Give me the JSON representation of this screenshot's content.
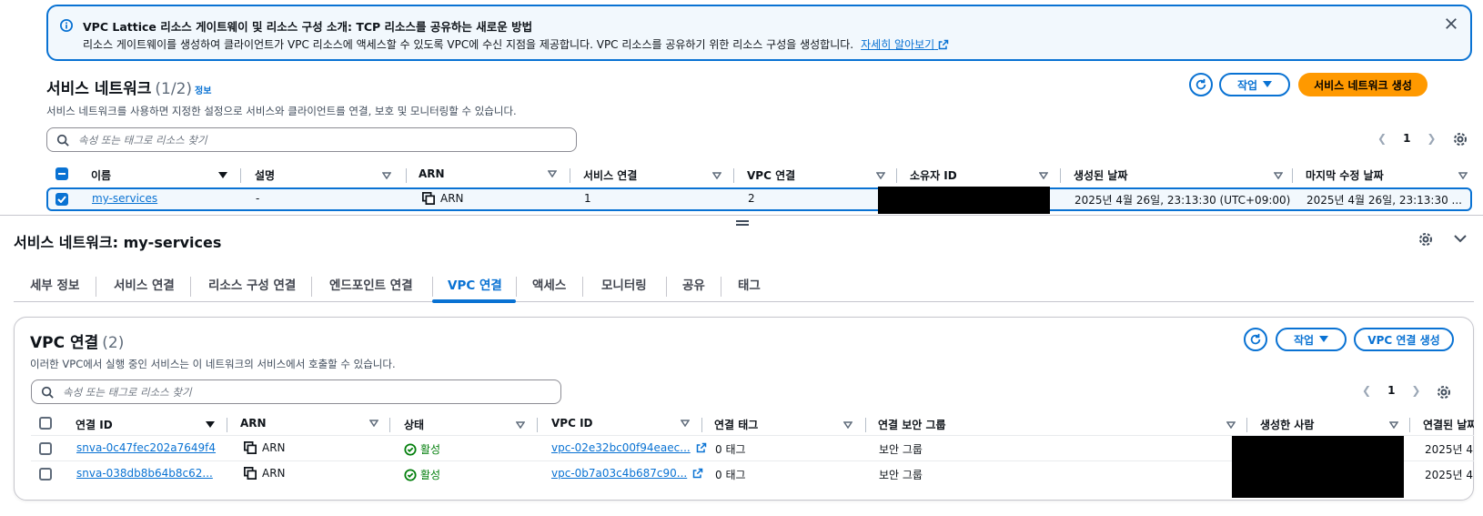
{
  "banner": {
    "title": "VPC Lattice 리소스 게이트웨이 및 리소스 구성 소개: TCP 리소스를 공유하는 새로운 방법",
    "description": "리소스 게이트웨이를 생성하여 클라이언트가 VPC 리소스에 액세스할 수 있도록 VPC에 수신 지점을 제공합니다. VPC 리소스를 공유하기 위한 리소스 구성을 생성합니다.",
    "learn_more": "자세히 알아보기"
  },
  "networks": {
    "title": "서비스 네트워크",
    "count": "(1/2)",
    "info": "정보",
    "description": "서비스 네트워크를 사용하면 지정한 설정으로 서비스와 클라이언트를 연결, 보호 및 모니터링할 수 있습니다.",
    "actions_label": "작업",
    "create_label": "서비스 네트워크 생성",
    "search_placeholder": "속성 또는 태그로 리소스 찾기",
    "page": "1",
    "columns": [
      "이름",
      "설명",
      "ARN",
      "서비스 연결",
      "VPC 연결",
      "소유자 ID",
      "생성된 날짜",
      "마지막 수정 날짜"
    ],
    "rows": [
      {
        "name": "my-services",
        "description": "-",
        "arn": "ARN",
        "service_assoc": "1",
        "vpc_assoc": "2",
        "created": "2025년 4월 26일, 23:13:30 (UTC+09:00)",
        "modified": "2025년 4월 26일, 23:13:30 ..."
      }
    ]
  },
  "details": {
    "title": "서비스 네트워크: my-services",
    "tabs": [
      "세부 정보",
      "서비스 연결",
      "리소스 구성 연결",
      "엔드포인트 연결",
      "VPC 연결",
      "액세스",
      "모니터링",
      "공유",
      "태그"
    ],
    "active_tab": "VPC 연결"
  },
  "vpc_assoc": {
    "title": "VPC 연결",
    "count": "(2)",
    "description": "이러한 VPC에서 실행 중인 서비스는 이 네트워크의 서비스에서 호출할 수 있습니다.",
    "actions_label": "작업",
    "create_label": "VPC 연결 생성",
    "search_placeholder": "속성 또는 태그로 리소스 찾기",
    "page": "1",
    "columns": [
      "연결 ID",
      "ARN",
      "상태",
      "VPC ID",
      "연결 태그",
      "연결 보안 그룹",
      "생성한 사람",
      "연결된 날짜"
    ],
    "rows": [
      {
        "id": "snva-0c47fec202a7649f4",
        "arn": "ARN",
        "status": "활성",
        "vpc_id": "vpc-02e32bc00f94eaec...",
        "tags": "0 태그",
        "sg": "보안 그룹",
        "date": "2025년 4"
      },
      {
        "id": "snva-038db8b64b8c62...",
        "arn": "ARN",
        "status": "활성",
        "vpc_id": "vpc-0b7a03c4b687c90...",
        "tags": "0 태그",
        "sg": "보안 그룹",
        "date": "2025년 4"
      }
    ]
  },
  "colors": {
    "accent": "#0972d3",
    "primary": "#ff9900",
    "success": "#037f0c"
  }
}
